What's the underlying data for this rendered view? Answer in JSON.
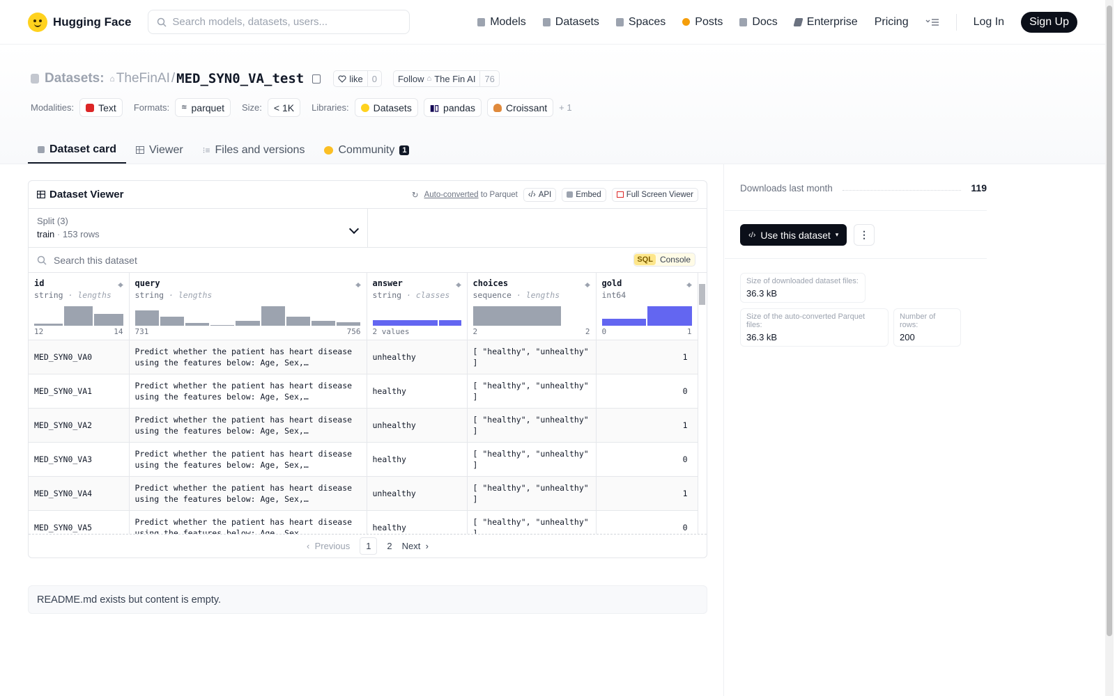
{
  "nav": {
    "brand": "Hugging Face",
    "search_placeholder": "Search models, datasets, users...",
    "links": [
      {
        "label": "Models",
        "icon": "cube-icon"
      },
      {
        "label": "Datasets",
        "icon": "database-icon"
      },
      {
        "label": "Spaces",
        "icon": "grid-icon"
      },
      {
        "label": "Posts",
        "icon": "chat-dot-icon"
      },
      {
        "label": "Docs",
        "icon": "doc-icon"
      },
      {
        "label": "Enterprise",
        "icon": "enterprise-icon"
      },
      {
        "label": "Pricing"
      }
    ],
    "login": "Log In",
    "signup": "Sign Up"
  },
  "header": {
    "section": "Datasets:",
    "owner": "TheFinAI",
    "slash": "/",
    "name": "MED_SYN0_VA_test",
    "like_label": "like",
    "like_count": "0",
    "follow_label": "Follow",
    "follow_org": "The Fin AI",
    "follow_count": "76",
    "modalities_label": "Modalities:",
    "modality": "Text",
    "formats_label": "Formats:",
    "format": "parquet",
    "size_label": "Size:",
    "size": "< 1K",
    "libraries_label": "Libraries:",
    "libraries": [
      "Datasets",
      "pandas",
      "Croissant"
    ],
    "more_libraries": "+ 1"
  },
  "tabs": [
    {
      "label": "Dataset card"
    },
    {
      "label": "Viewer"
    },
    {
      "label": "Files and versions"
    },
    {
      "label": "Community",
      "badge": "1"
    }
  ],
  "viewer": {
    "title": "Dataset Viewer",
    "auto_converted": "Auto-converted",
    "to_parquet": "to Parquet",
    "api": "API",
    "embed": "Embed",
    "full_screen": "Full Screen Viewer",
    "split_label": "Split (3)",
    "split_value": "train",
    "split_rows": "153 rows",
    "search_placeholder": "Search this dataset",
    "sql_badge": "SQL",
    "sql_console": "Console",
    "columns": [
      {
        "name": "id",
        "type": "string",
        "stat": "lengths",
        "min": "12",
        "max": "14",
        "hist": [
          0.1,
          1.0,
          0.6
        ],
        "hist_color": "#9ca3af"
      },
      {
        "name": "query",
        "type": "string",
        "stat": "lengths",
        "min": "731",
        "max": "756",
        "hist": [
          0.8,
          0.45,
          0.15,
          0.05,
          0.25,
          1.0,
          0.45,
          0.25,
          0.18
        ],
        "hist_color": "#9ca3af"
      },
      {
        "name": "answer",
        "type": "string",
        "stat": "classes",
        "min": "2 values",
        "max": "",
        "hist": [
          0.75,
          0.25
        ],
        "hist_color": "#6366f1"
      },
      {
        "name": "choices",
        "type": "sequence",
        "stat": "lengths",
        "min": "2",
        "max": "2",
        "hist": [
          1.0
        ],
        "hist_color": "#9ca3af"
      },
      {
        "name": "gold",
        "type": "int64",
        "stat": "",
        "min": "0",
        "max": "1",
        "hist": [
          0.35,
          1.0
        ],
        "hist_color": "#6366f1"
      }
    ],
    "rows": [
      {
        "id": "MED_SYN0_VA0",
        "query": "Predict whether the patient has heart disease using the features below: Age, Sex,…",
        "answer": "unhealthy",
        "choices": "[ \"healthy\", \"unhealthy\" ]",
        "gold": "1"
      },
      {
        "id": "MED_SYN0_VA1",
        "query": "Predict whether the patient has heart disease using the features below: Age, Sex,…",
        "answer": "healthy",
        "choices": "[ \"healthy\", \"unhealthy\" ]",
        "gold": "0"
      },
      {
        "id": "MED_SYN0_VA2",
        "query": "Predict whether the patient has heart disease using the features below: Age, Sex,…",
        "answer": "unhealthy",
        "choices": "[ \"healthy\", \"unhealthy\" ]",
        "gold": "1"
      },
      {
        "id": "MED_SYN0_VA3",
        "query": "Predict whether the patient has heart disease using the features below: Age, Sex,…",
        "answer": "healthy",
        "choices": "[ \"healthy\", \"unhealthy\" ]",
        "gold": "0"
      },
      {
        "id": "MED_SYN0_VA4",
        "query": "Predict whether the patient has heart disease using the features below: Age, Sex,…",
        "answer": "unhealthy",
        "choices": "[ \"healthy\", \"unhealthy\" ]",
        "gold": "1"
      },
      {
        "id": "MED_SYN0_VA5",
        "query": "Predict whether the patient has heart disease using the features below: Age, Sex,…",
        "answer": "healthy",
        "choices": "[ \"healthy\", \"unhealthy\" ]",
        "gold": "0"
      }
    ],
    "pager": {
      "previous": "Previous",
      "pages": [
        "1",
        "2"
      ],
      "next": "Next"
    }
  },
  "readme": "README.md exists but content is empty.",
  "sidebar": {
    "downloads_label": "Downloads last month",
    "downloads_value": "119",
    "use_button": "Use this dataset",
    "size_download_label": "Size of downloaded dataset files:",
    "size_download_value": "36.3 kB",
    "size_parquet_label": "Size of the auto-converted Parquet files:",
    "size_parquet_value": "36.3 kB",
    "rows_label": "Number of rows:",
    "rows_value": "200"
  }
}
